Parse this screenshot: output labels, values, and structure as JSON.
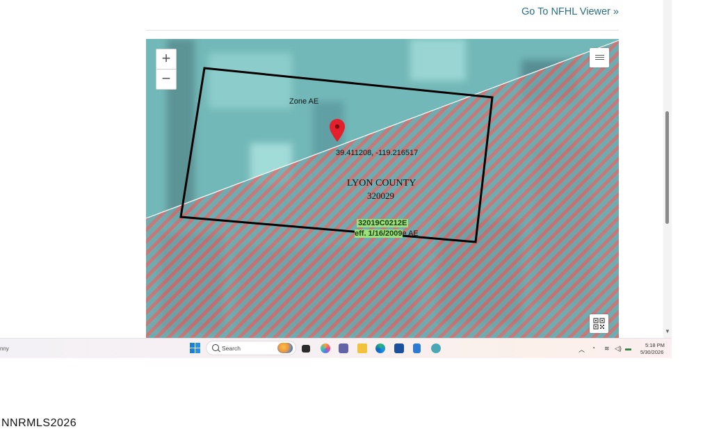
{
  "header": {
    "viewer_link": "Go To NFHL Viewer »"
  },
  "map": {
    "zoom_in": "+",
    "zoom_out": "−",
    "zone_label": "Zone AE",
    "coordinates": "39.411208, -119.216517",
    "county_name": "LYON COUNTY",
    "county_code": "320029",
    "panel_number": "32019C0212E",
    "effective_prefix": "eff. 1/16/2009",
    "effective_suffix": "e AE",
    "colors": {
      "imagery": "#6fb3b4",
      "hatch_red": "#e0605e",
      "boundary": "#000000",
      "marker": "#e3202b"
    }
  },
  "taskbar": {
    "left_fragment": "nny",
    "search_placeholder": "Search",
    "time": "5:18 PM",
    "date": "5/30/2026",
    "icons": [
      "windows-start-icon",
      "search-icon",
      "task-view-icon",
      "copilot-icon",
      "teams-icon",
      "file-explorer-icon",
      "edge-icon",
      "store-icon",
      "notepad-icon",
      "app-icon",
      "chevron-up-icon",
      "wifi-icon",
      "volume-icon",
      "battery-icon"
    ]
  },
  "watermark": "NNRMLS2026"
}
